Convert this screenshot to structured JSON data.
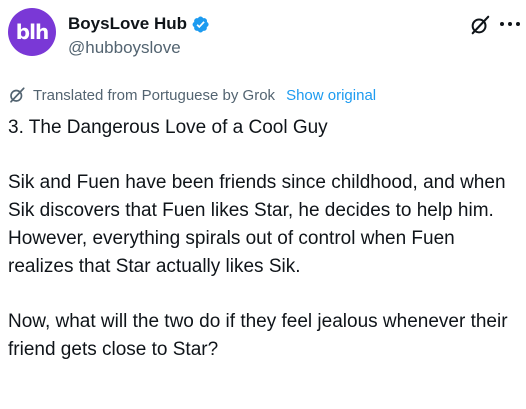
{
  "author": {
    "avatar_text": "blh",
    "display_name": "BoysLove Hub",
    "handle": "@hubboyslove",
    "verified": true
  },
  "icons": {
    "top_right": "grok-icon",
    "menu": "more-icon",
    "translation": "grok-icon",
    "verified": "verified-badge-icon"
  },
  "translation": {
    "label": "Translated from Portuguese by Grok",
    "show_original": "Show original"
  },
  "post": {
    "title": "3. The Dangerous Love of a Cool Guy",
    "paragraph1": "Sik and Fuen have been friends since childhood, and when Sik discovers that Fuen likes Star, he decides to help him. However, everything spirals out of control when Fuen realizes that Star actually likes Sik.",
    "paragraph2": "Now, what will the two do if they feel jealous whenever their friend gets close to Star?"
  },
  "colors": {
    "avatar_bg": "#7a38d6",
    "verified_blue": "#1d9bf0",
    "link_blue": "#1d9bf0",
    "secondary_text": "#536471",
    "primary_text": "#0f1419"
  }
}
